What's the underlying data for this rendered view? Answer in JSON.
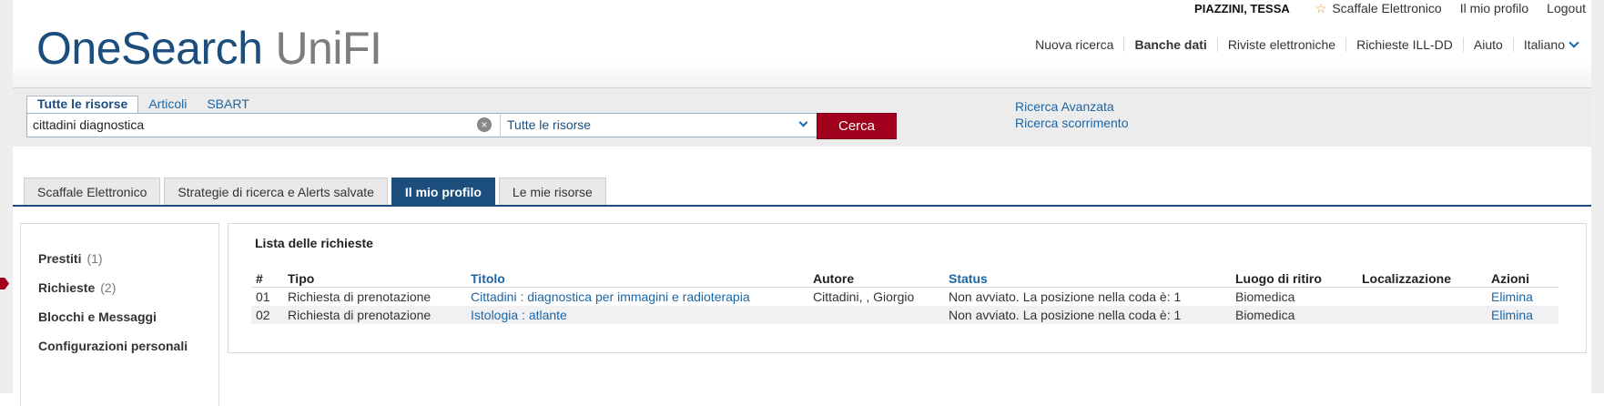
{
  "userbar": {
    "user": "PIAZZINI, TESSA",
    "shelf": "Scaffale Elettronico",
    "profile": "Il mio profilo",
    "logout": "Logout"
  },
  "logo": {
    "part1": "OneSearch",
    "part2": "UniFI"
  },
  "nav": [
    "Nuova ricerca",
    "Banche dati",
    "Riviste elettroniche",
    "Richieste ILL-DD",
    "Aiuto",
    "Italiano"
  ],
  "search": {
    "tabs": [
      "Tutte le risorse",
      "Articoli",
      "SBART"
    ],
    "query": "cittadini diagnostica",
    "scope": "Tutte le risorse",
    "button": "Cerca",
    "advanced": "Ricerca Avanzata",
    "browse": "Ricerca scorrimento"
  },
  "page_tabs": [
    "Scaffale Elettronico",
    "Strategie di ricerca e Alerts salvate",
    "Il mio profilo",
    "Le mie risorse"
  ],
  "side": {
    "items": [
      {
        "label": "Prestiti",
        "count": "(1)"
      },
      {
        "label": "Richieste",
        "count": "(2)"
      },
      {
        "label": "Blocchi e Messaggi",
        "count": ""
      },
      {
        "label": "Configurazioni personali",
        "count": ""
      }
    ]
  },
  "main": {
    "title": "Lista delle richieste",
    "columns": [
      "#",
      "Tipo",
      "Titolo",
      "Autore",
      "Status",
      "Luogo di ritiro",
      "Localizzazione",
      "Azioni"
    ],
    "rows": [
      [
        "01",
        "Richiesta di prenotazione",
        "Cittadini : diagnostica per immagini e radioterapia",
        "Cittadini, , Giorgio",
        "Non avviato. La posizione nella coda è: 1",
        "Biomedica",
        "",
        "Elimina"
      ],
      [
        "02",
        "Richiesta di prenotazione",
        "Istologia : atlante",
        "",
        "Non avviato. La posizione nella coda è: 1",
        "Biomedica",
        "",
        "Elimina"
      ]
    ]
  },
  "colors": {
    "brand": "#1b4e7d",
    "accent": "#a0001c",
    "link": "#1b66a6"
  }
}
